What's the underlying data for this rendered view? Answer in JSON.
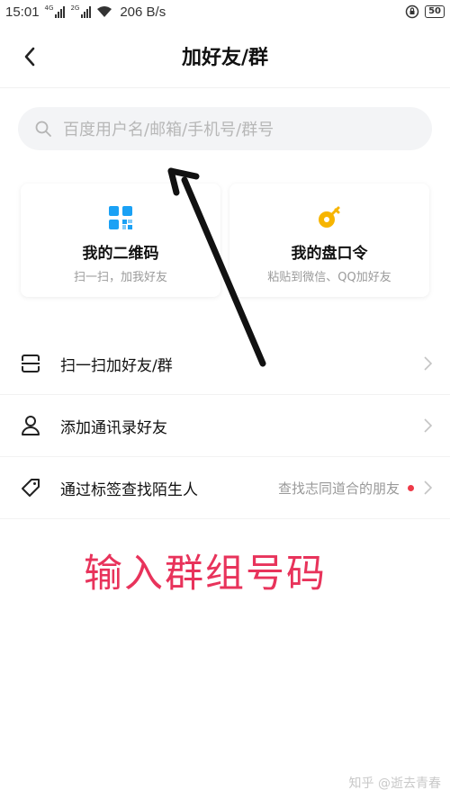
{
  "status_bar": {
    "time": "15:01",
    "sim1_tag": "4G",
    "sim2_tag": "2G",
    "network_speed": "206 B/s",
    "battery": "50"
  },
  "nav": {
    "back_icon": "chevron-left-icon",
    "title": "加好友/群"
  },
  "search": {
    "icon": "search-icon",
    "placeholder": "百度用户名/邮箱/手机号/群号"
  },
  "cards": [
    {
      "icon": "qr-code-icon",
      "title": "我的二维码",
      "subtitle": "扫一扫，加我好友",
      "icon_color": "#1aa1f5"
    },
    {
      "icon": "key-icon",
      "title": "我的盘口令",
      "subtitle": "粘贴到微信、QQ加好友",
      "icon_color": "#f7b500"
    }
  ],
  "rows": [
    {
      "icon": "scan-icon",
      "label": "扫一扫加好友/群",
      "hint": ""
    },
    {
      "icon": "contact-person-icon",
      "label": "添加通讯录好友",
      "hint": ""
    },
    {
      "icon": "tag-icon",
      "label": "通过标签查找陌生人",
      "hint": "查找志同道合的朋友",
      "dot_color": "#ee3a48"
    }
  ],
  "annotation": {
    "text": "输入群组号码",
    "color": "#e8335b"
  },
  "watermark": "知乎 @逝去青春"
}
